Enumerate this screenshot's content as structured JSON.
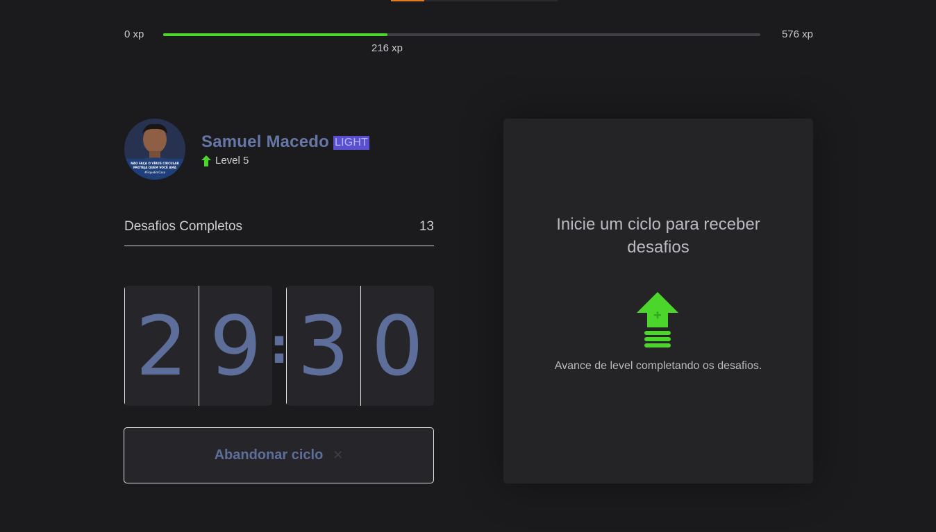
{
  "xp_bar": {
    "min_label": "0 xp",
    "max_label": "576 xp",
    "current_label": "216 xp",
    "current_xp": 216,
    "max_xp": 576,
    "fill_color": "#4cd62b"
  },
  "profile": {
    "name": "Samuel Macedo",
    "badge": "LIGHT",
    "level_label": "Level 5",
    "avatar_caption": [
      "NÃO FAÇA O VÍRUS CIRCULAR",
      "PROTEJA QUEM VOCÊ AMA",
      "#FiqueEmCasa"
    ],
    "level_icon": "level-up-arrow-icon"
  },
  "completed_challenges": {
    "label": "Desafios Completos",
    "value": "13"
  },
  "countdown": {
    "minutes": [
      "2",
      "9"
    ],
    "separator": ":",
    "seconds": [
      "3",
      "0"
    ]
  },
  "abandon_button": {
    "label": "Abandonar ciclo",
    "icon": "close-icon",
    "icon_glyph": "✕"
  },
  "challenge_box": {
    "title": "Inicie um ciclo para receber desafios",
    "icon": "level-up-icon",
    "text": "Avance de level completando os desafios."
  },
  "colors": {
    "accent_green": "#4cd62b",
    "accent_blue": "#5e6e9a",
    "badge_purple": "#5a4fd0",
    "top_accent_orange": "#e07d1c"
  }
}
